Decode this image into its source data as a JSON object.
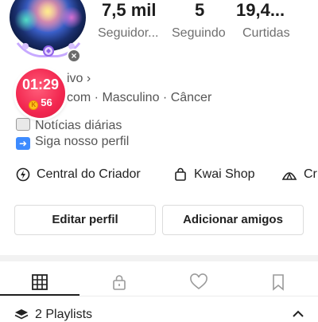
{
  "stats": [
    {
      "value": "7,5 mil",
      "label": "Seguidor..."
    },
    {
      "value": "5",
      "label": "Seguindo"
    },
    {
      "value": "19,4...",
      "label": "Curtidas"
    }
  ],
  "profile": {
    "status_suffix": "ivo",
    "info_line": "com · Masculino · Câncer",
    "bio": [
      "Notícias diárias",
      "Siga nosso perfil"
    ]
  },
  "timer_badge": {
    "time": "01:29",
    "coins": "56"
  },
  "shortcuts": [
    {
      "label": "Central do Criador",
      "icon": "lightning-icon"
    },
    {
      "label": "Kwai Shop",
      "icon": "shopping-bag-icon"
    },
    {
      "label": "Cr",
      "icon": "tent-icon"
    }
  ],
  "actions": {
    "edit_profile": "Editar perfil",
    "add_friends": "Adicionar amigos"
  },
  "tabs": [
    {
      "icon": "grid-icon",
      "selected": true
    },
    {
      "icon": "lock-icon",
      "selected": false
    },
    {
      "icon": "heart-icon",
      "selected": false
    },
    {
      "icon": "bookmark-icon",
      "selected": false
    }
  ],
  "playlists": {
    "label": "2 Playlists"
  },
  "colors": {
    "timer_red": "#f2264f",
    "text_dark": "#222222",
    "text_muted": "#6f6f6f"
  }
}
